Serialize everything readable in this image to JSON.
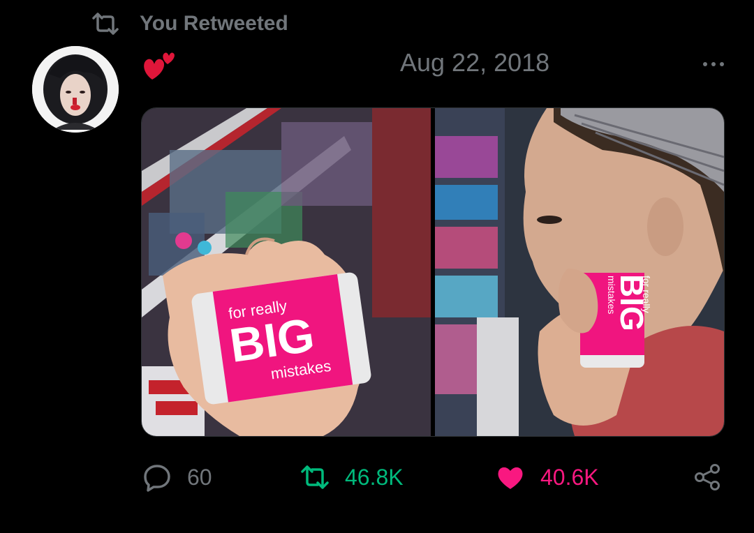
{
  "retweet_banner": {
    "label": "You Retweeted"
  },
  "tweet": {
    "date": "Aug 22, 2018",
    "media": {
      "left_eraser": {
        "top_text": "for really",
        "big_text": "BIG",
        "bottom_text": "mistakes"
      },
      "right_eraser": {
        "top_text": "for really",
        "big_text": "BIG",
        "bottom_text": "mistakes"
      }
    },
    "actions": {
      "reply_count": "60",
      "retweet_count": "46.8K",
      "like_count": "40.6K"
    }
  },
  "colors": {
    "background": "#000000",
    "muted": "#71767b",
    "retweet_green": "#00ba7c",
    "like_pink": "#f91880",
    "eraser_pink": "#f0157f"
  },
  "icons": [
    "retweet-icon",
    "hearts-emoji-icon",
    "more-icon",
    "reply-icon",
    "like-icon",
    "share-icon"
  ]
}
